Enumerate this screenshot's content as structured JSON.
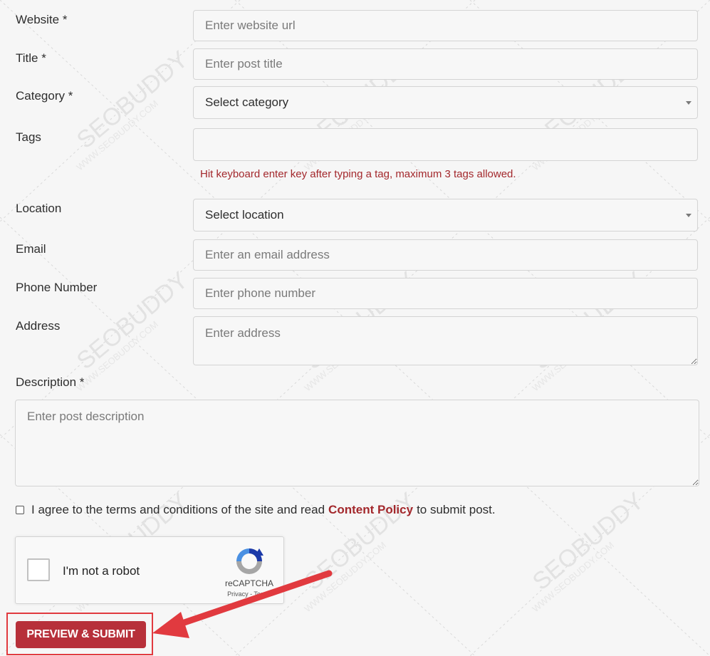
{
  "fields": {
    "website": {
      "label": "Website *",
      "placeholder": "Enter website url"
    },
    "title": {
      "label": "Title *",
      "placeholder": "Enter post title"
    },
    "category": {
      "label": "Category *",
      "selected": "Select category"
    },
    "tags": {
      "label": "Tags",
      "hint": "Hit keyboard enter key after typing a tag, maximum 3 tags allowed."
    },
    "location": {
      "label": "Location",
      "selected": "Select location"
    },
    "email": {
      "label": "Email",
      "placeholder": "Enter an email address"
    },
    "phone": {
      "label": "Phone Number",
      "placeholder": "Enter phone number"
    },
    "address": {
      "label": "Address",
      "placeholder": "Enter address"
    },
    "description": {
      "label": "Description *",
      "placeholder": "Enter post description"
    }
  },
  "terms": {
    "text_before": "I agree to the terms and conditions of the site and read",
    "link": "Content Policy",
    "text_after": "to submit post."
  },
  "recaptcha": {
    "label": "I'm not a robot",
    "brand": "reCAPTCHA",
    "links": "Privacy - Terms"
  },
  "submit": {
    "label": "PREVIEW & SUBMIT"
  },
  "colors": {
    "accent": "#b7303a",
    "highlight": "#e13a3f",
    "hint": "#a3282c"
  }
}
